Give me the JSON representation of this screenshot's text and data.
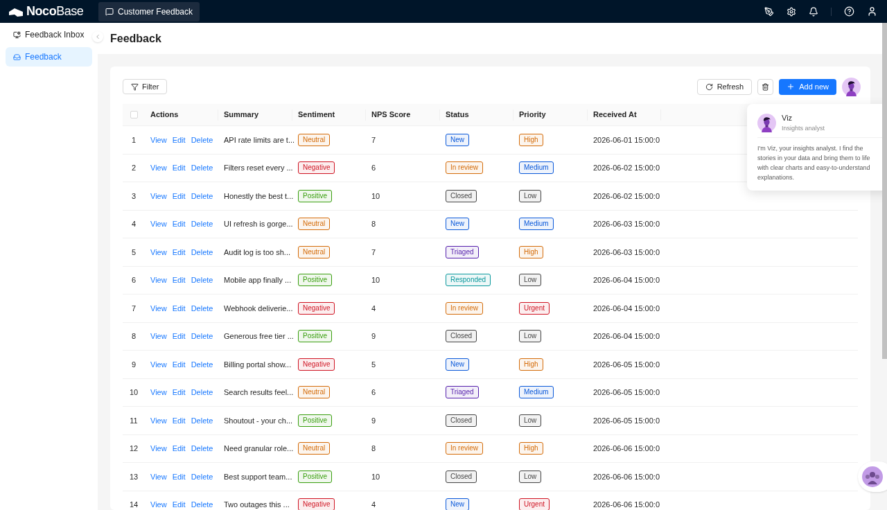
{
  "topbar": {
    "logo_bold": "Noco",
    "logo_light": "Base",
    "app_tab": {
      "label": "Customer Feedback",
      "selected": true
    }
  },
  "sidebar": {
    "items": [
      {
        "label": "Feedback Inbox",
        "selected": false,
        "kind": "inbox"
      },
      {
        "label": "Feedback",
        "selected": true,
        "kind": "tray"
      }
    ]
  },
  "page": {
    "title": "Feedback"
  },
  "toolbar": {
    "filter": "Filter",
    "refresh": "Refresh",
    "add": "Add new"
  },
  "table": {
    "columns": [
      "Actions",
      "Summary",
      "Sentiment",
      "NPS Score",
      "Status",
      "Priority",
      "Received At"
    ],
    "select_all": {
      "checked": false
    },
    "rows": [
      {
        "actions": [
          "View",
          "Edit",
          "Delete"
        ],
        "index": "1",
        "summary": "API rate limits are t...",
        "sentiment": {
          "label": "Neutral",
          "color": "#d46b08"
        },
        "nps": "7",
        "status": {
          "label": "New",
          "color": "#0958d9"
        },
        "priority": {
          "label": "High",
          "color": "#d46b08"
        },
        "received": "2026-06-01 15:00:0"
      },
      {
        "actions": [
          "View",
          "Edit",
          "Delete"
        ],
        "index": "2",
        "summary": "Filters reset every ...",
        "sentiment": {
          "label": "Negative",
          "color": "#cf1322"
        },
        "nps": "6",
        "status": {
          "label": "In review",
          "color": "#d46b08"
        },
        "priority": {
          "label": "Medium",
          "color": "#0958d9"
        },
        "received": "2026-06-02 15:00:0"
      },
      {
        "actions": [
          "View",
          "Edit",
          "Delete"
        ],
        "index": "3",
        "summary": "Honestly the best t...",
        "sentiment": {
          "label": "Positive",
          "color": "#389e0d"
        },
        "nps": "10",
        "status": {
          "label": "Closed",
          "color": "#434343"
        },
        "priority": {
          "label": "Low",
          "color": "#434343"
        },
        "received": "2026-06-02 15:00:0"
      },
      {
        "actions": [
          "View",
          "Edit",
          "Delete"
        ],
        "index": "4",
        "summary": "UI refresh is gorge...",
        "sentiment": {
          "label": "Neutral",
          "color": "#d46b08"
        },
        "nps": "8",
        "status": {
          "label": "New",
          "color": "#0958d9"
        },
        "priority": {
          "label": "Medium",
          "color": "#0958d9"
        },
        "received": "2026-06-03 15:00:0"
      },
      {
        "actions": [
          "View",
          "Edit",
          "Delete"
        ],
        "index": "5",
        "summary": "Audit log is too sh...",
        "sentiment": {
          "label": "Neutral",
          "color": "#d46b08"
        },
        "nps": "7",
        "status": {
          "label": "Triaged",
          "color": "#531dab"
        },
        "priority": {
          "label": "High",
          "color": "#d46b08"
        },
        "received": "2026-06-03 15:00:0"
      },
      {
        "actions": [
          "View",
          "Edit",
          "Delete"
        ],
        "index": "6",
        "summary": "Mobile app finally ...",
        "sentiment": {
          "label": "Positive",
          "color": "#389e0d"
        },
        "nps": "10",
        "status": {
          "label": "Responded",
          "color": "#08979c"
        },
        "priority": {
          "label": "Low",
          "color": "#434343"
        },
        "received": "2026-06-04 15:00:0"
      },
      {
        "actions": [
          "View",
          "Edit",
          "Delete"
        ],
        "index": "7",
        "summary": "Webhook deliverie...",
        "sentiment": {
          "label": "Negative",
          "color": "#cf1322"
        },
        "nps": "4",
        "status": {
          "label": "In review",
          "color": "#d46b08"
        },
        "priority": {
          "label": "Urgent",
          "color": "#cf1322"
        },
        "received": "2026-06-04 15:00:0"
      },
      {
        "actions": [
          "View",
          "Edit",
          "Delete"
        ],
        "index": "8",
        "summary": "Generous free tier ...",
        "sentiment": {
          "label": "Positive",
          "color": "#389e0d"
        },
        "nps": "9",
        "status": {
          "label": "Closed",
          "color": "#434343"
        },
        "priority": {
          "label": "Low",
          "color": "#434343"
        },
        "received": "2026-06-04 15:00:0"
      },
      {
        "actions": [
          "View",
          "Edit",
          "Delete"
        ],
        "index": "9",
        "summary": "Billing portal show...",
        "sentiment": {
          "label": "Negative",
          "color": "#cf1322"
        },
        "nps": "5",
        "status": {
          "label": "New",
          "color": "#0958d9"
        },
        "priority": {
          "label": "High",
          "color": "#d46b08"
        },
        "received": "2026-06-05 15:00:0"
      },
      {
        "actions": [
          "View",
          "Edit",
          "Delete"
        ],
        "index": "10",
        "summary": "Search results feel...",
        "sentiment": {
          "label": "Neutral",
          "color": "#d46b08"
        },
        "nps": "6",
        "status": {
          "label": "Triaged",
          "color": "#531dab"
        },
        "priority": {
          "label": "Medium",
          "color": "#0958d9"
        },
        "received": "2026-06-05 15:00:0"
      },
      {
        "actions": [
          "View",
          "Edit",
          "Delete"
        ],
        "index": "11",
        "summary": "Shoutout - your ch...",
        "sentiment": {
          "label": "Positive",
          "color": "#389e0d"
        },
        "nps": "9",
        "status": {
          "label": "Closed",
          "color": "#434343"
        },
        "priority": {
          "label": "Low",
          "color": "#434343"
        },
        "received": "2026-06-05 15:00:0"
      },
      {
        "actions": [
          "View",
          "Edit",
          "Delete"
        ],
        "index": "12",
        "summary": "Need granular role...",
        "sentiment": {
          "label": "Neutral",
          "color": "#d46b08"
        },
        "nps": "8",
        "status": {
          "label": "In review",
          "color": "#d46b08"
        },
        "priority": {
          "label": "High",
          "color": "#d46b08"
        },
        "received": "2026-06-06 15:00:0"
      },
      {
        "actions": [
          "View",
          "Edit",
          "Delete"
        ],
        "index": "13",
        "summary": "Best support team...",
        "sentiment": {
          "label": "Positive",
          "color": "#389e0d"
        },
        "nps": "10",
        "status": {
          "label": "Closed",
          "color": "#434343"
        },
        "priority": {
          "label": "Low",
          "color": "#434343"
        },
        "received": "2026-06-06 15:00:0"
      },
      {
        "actions": [
          "View",
          "Edit",
          "Delete"
        ],
        "index": "14",
        "summary": "Two outages this ...",
        "sentiment": {
          "label": "Negative",
          "color": "#cf1322"
        },
        "nps": "4",
        "status": {
          "label": "New",
          "color": "#0958d9"
        },
        "priority": {
          "label": "Urgent",
          "color": "#cf1322"
        },
        "received": "2026-06-06 15:00:0"
      }
    ]
  },
  "assistant_card": {
    "name": "Viz",
    "role": "Insights analyst",
    "intro": "I'm Viz, your insights analyst. I find the stories in your data and bring them to life with clear charts and easy-to-understand explanations."
  }
}
